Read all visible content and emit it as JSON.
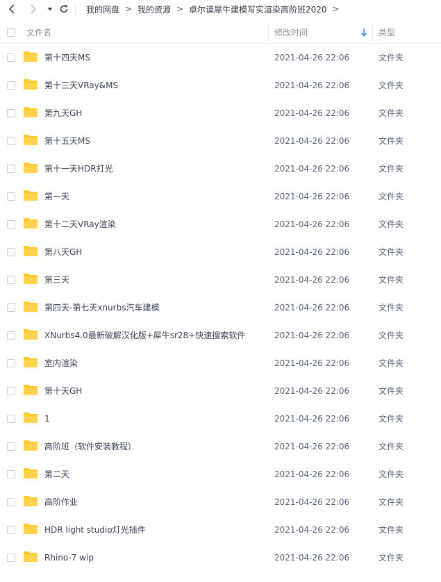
{
  "nav": {
    "back_icon": "chevron-left-icon",
    "forward_icon": "chevron-right-icon",
    "dropdown_icon": "caret-down-icon",
    "refresh_icon": "refresh-icon"
  },
  "breadcrumb": {
    "items": [
      "我的网盘",
      "我的资源",
      "卓尔谟犀牛建模写实渲染高阶班2020"
    ],
    "separator": ">"
  },
  "header": {
    "name": "文件名",
    "modified": "修改时间",
    "type": "类型",
    "sort_icon": "arrow-down-icon"
  },
  "colors": {
    "folder": "#ffc82d",
    "sort_arrow": "#3b8cff"
  },
  "files": [
    {
      "name": "第十四天MS",
      "date": "2021-04-26 22:06",
      "type": "文件夹"
    },
    {
      "name": "第十三天VRay&MS",
      "date": "2021-04-26 22:06",
      "type": "文件夹"
    },
    {
      "name": "第九天GH",
      "date": "2021-04-26 22:06",
      "type": "文件夹"
    },
    {
      "name": "第十五天MS",
      "date": "2021-04-26 22:06",
      "type": "文件夹"
    },
    {
      "name": "第十一天HDR打光",
      "date": "2021-04-26 22:06",
      "type": "文件夹"
    },
    {
      "name": "第一天",
      "date": "2021-04-26 22:06",
      "type": "文件夹"
    },
    {
      "name": "第十二天VRay渲染",
      "date": "2021-04-26 22:06",
      "type": "文件夹"
    },
    {
      "name": "第八天GH",
      "date": "2021-04-26 22:06",
      "type": "文件夹"
    },
    {
      "name": "第三天",
      "date": "2021-04-26 22:06",
      "type": "文件夹"
    },
    {
      "name": "第四天-第七天xnurbs汽车建模",
      "date": "2021-04-26 22:06",
      "type": "文件夹"
    },
    {
      "name": "XNurbs4.0最新破解汉化版+犀牛sr28+快速搜索软件",
      "date": "2021-04-26 22:06",
      "type": "文件夹"
    },
    {
      "name": "室内渲染",
      "date": "2021-04-26 22:06",
      "type": "文件夹"
    },
    {
      "name": "第十天GH",
      "date": "2021-04-26 22:06",
      "type": "文件夹"
    },
    {
      "name": "1",
      "date": "2021-04-26 22:06",
      "type": "文件夹"
    },
    {
      "name": "高阶班（软件安装教程）",
      "date": "2021-04-26 22:06",
      "type": "文件夹"
    },
    {
      "name": "第二天",
      "date": "2021-04-26 22:06",
      "type": "文件夹"
    },
    {
      "name": "高阶作业",
      "date": "2021-04-26 22:06",
      "type": "文件夹"
    },
    {
      "name": "HDR light studio灯光插件",
      "date": "2021-04-26 22:06",
      "type": "文件夹"
    },
    {
      "name": "Rhino-7 wip",
      "date": "2021-04-26 22:06",
      "type": "文件夹"
    }
  ]
}
